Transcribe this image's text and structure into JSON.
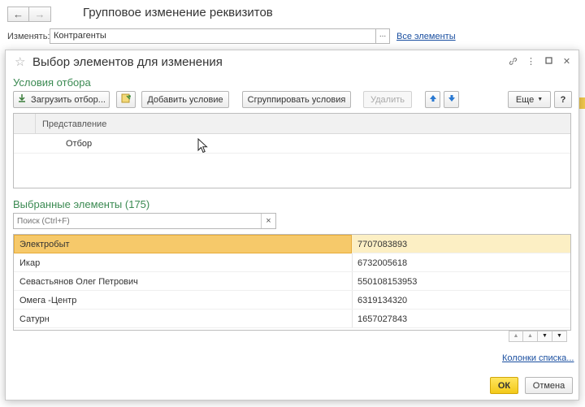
{
  "background": {
    "title": "Групповое изменение реквизитов",
    "change_label": "Изменять:",
    "change_value": "Контрагенты",
    "dots": "...",
    "all_elements_link": "Все элементы"
  },
  "dialog": {
    "title": "Выбор элементов для изменения",
    "filter_section_title": "Условия отбора",
    "toolbar": {
      "load_filter": "Загрузить отбор...",
      "add_condition": "Добавить условие",
      "group_conditions": "Сгруппировать условия",
      "delete": "Удалить",
      "more": "Еще",
      "help": "?"
    },
    "filter_grid": {
      "column": "Представление",
      "rows": [
        "Отбор"
      ]
    },
    "selected_title": "Выбранные элементы (175)",
    "search_placeholder": "Поиск (Ctrl+F)",
    "items": [
      {
        "name": "Электробыт",
        "inn": "7707083893"
      },
      {
        "name": "Икар",
        "inn": "6732005618"
      },
      {
        "name": "Севастьянов Олег Петрович",
        "inn": "550108153953"
      },
      {
        "name": "Омега -Центр",
        "inn": "6319134320"
      },
      {
        "name": "Сатурн",
        "inn": "1657027843"
      }
    ],
    "columns_link": "Колонки списка...",
    "ok": "ОК",
    "cancel": "Отмена"
  },
  "icons": {
    "back": "arrow-left-icon",
    "forward": "arrow-right-icon",
    "star": "star-icon",
    "link": "link-icon",
    "menu": "kebab-menu-icon",
    "maximize": "maximize-icon",
    "close": "close-icon"
  },
  "colors": {
    "section_title": "#3b8a52",
    "link": "#1a4fa0",
    "selected_row": "#f6c96a",
    "ok_button": "#f3c919",
    "arrow_blue": "#2a79d2"
  }
}
